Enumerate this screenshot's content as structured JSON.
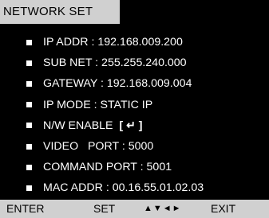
{
  "title": "NETWORK SET",
  "menu": {
    "items": [
      {
        "label": "IP ADDR : 192.168.009.200"
      },
      {
        "label": "SUB NET : 255.255.240.000"
      },
      {
        "label": "GATEWAY : 192.168.009.004"
      },
      {
        "label": "IP MODE : STATIC IP"
      },
      {
        "label": "N/W ENABLE",
        "extra": "[ ↵ ]"
      },
      {
        "label": "VIDEO   PORT : 5000"
      },
      {
        "label": "COMMAND PORT : 5001"
      },
      {
        "label": "MAC ADDR : 00.16.55.01.02.03"
      }
    ]
  },
  "footer": {
    "enter": "ENTER",
    "set": "SET",
    "nav": "▲▼◄►",
    "exit": "EXIT"
  },
  "colors": {
    "background": "#000000",
    "bar": "#d0d0d0",
    "text": "#ffffff",
    "bar_text": "#000000"
  }
}
